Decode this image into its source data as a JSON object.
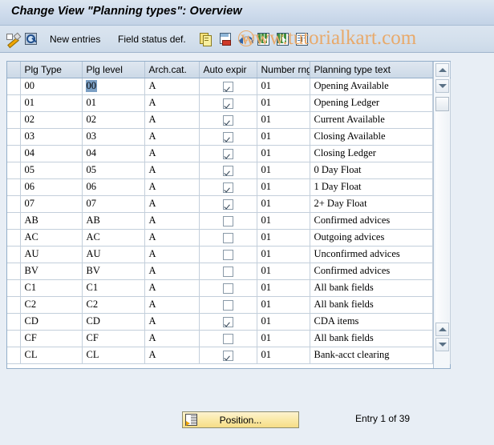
{
  "window": {
    "title": "Change View \"Planning types\": Overview"
  },
  "toolbar": {
    "items": [
      {
        "name": "change-display-icon",
        "label": "",
        "icon": "pencil-icon"
      },
      {
        "name": "display-details-icon",
        "label": "",
        "icon": "magnifier-icon"
      },
      {
        "name": "new-entries-button",
        "label": "New entries",
        "icon": ""
      },
      {
        "name": "field-status-def-button",
        "label": "Field status def.",
        "icon": ""
      },
      {
        "name": "copy-as-icon",
        "label": "",
        "icon": "copy-icon"
      },
      {
        "name": "delete-icon",
        "label": "",
        "icon": "delete-row-icon"
      },
      {
        "name": "undo-icon",
        "label": "",
        "icon": "undo-icon"
      },
      {
        "name": "select-all-icon",
        "label": "",
        "icon": "select-all-icon"
      },
      {
        "name": "deselect-all-icon",
        "label": "",
        "icon": "deselect-all-icon"
      },
      {
        "name": "select-block-icon",
        "label": "",
        "icon": "select-block-icon"
      }
    ]
  },
  "watermark": {
    "text": "www.tutorialkart.com",
    "mark": "c",
    "color": "#e8a96a"
  },
  "table": {
    "config_icon": "table-settings-icon",
    "columns": [
      {
        "key": "plg_type",
        "label": "Plg Type",
        "width": 77,
        "type": "key"
      },
      {
        "key": "plg_level",
        "label": "Plg level",
        "width": 78,
        "type": "text"
      },
      {
        "key": "arch_cat",
        "label": "Arch.cat.",
        "width": 68,
        "type": "text"
      },
      {
        "key": "auto_expir",
        "label": "Auto expir",
        "width": 72,
        "type": "check"
      },
      {
        "key": "number_rng",
        "label": "Number rng",
        "width": 66,
        "type": "text"
      },
      {
        "key": "type_text",
        "label": "Planning type text",
        "width": 138,
        "type": "longtext"
      }
    ],
    "selected_cell": {
      "row": 0,
      "column": "plg_level"
    },
    "rows": [
      {
        "plg_type": "00",
        "plg_level": "00",
        "arch_cat": "A",
        "auto_expir": true,
        "number_rng": "01",
        "type_text": "Opening Available"
      },
      {
        "plg_type": "01",
        "plg_level": "01",
        "arch_cat": "A",
        "auto_expir": true,
        "number_rng": "01",
        "type_text": "Opening Ledger"
      },
      {
        "plg_type": "02",
        "plg_level": "02",
        "arch_cat": "A",
        "auto_expir": true,
        "number_rng": "01",
        "type_text": "Current Available"
      },
      {
        "plg_type": "03",
        "plg_level": "03",
        "arch_cat": "A",
        "auto_expir": true,
        "number_rng": "01",
        "type_text": "Closing Available"
      },
      {
        "plg_type": "04",
        "plg_level": "04",
        "arch_cat": "A",
        "auto_expir": true,
        "number_rng": "01",
        "type_text": "Closing Ledger"
      },
      {
        "plg_type": "05",
        "plg_level": "05",
        "arch_cat": "A",
        "auto_expir": true,
        "number_rng": "01",
        "type_text": "0 Day Float"
      },
      {
        "plg_type": "06",
        "plg_level": "06",
        "arch_cat": "A",
        "auto_expir": true,
        "number_rng": "01",
        "type_text": "1 Day Float"
      },
      {
        "plg_type": "07",
        "plg_level": "07",
        "arch_cat": "A",
        "auto_expir": true,
        "number_rng": "01",
        "type_text": "2+ Day Float"
      },
      {
        "plg_type": "AB",
        "plg_level": "AB",
        "arch_cat": "A",
        "auto_expir": false,
        "number_rng": "01",
        "type_text": "Confirmed advices"
      },
      {
        "plg_type": "AC",
        "plg_level": "AC",
        "arch_cat": "A",
        "auto_expir": false,
        "number_rng": "01",
        "type_text": "Outgoing advices"
      },
      {
        "plg_type": "AU",
        "plg_level": "AU",
        "arch_cat": "A",
        "auto_expir": false,
        "number_rng": "01",
        "type_text": "Unconfirmed advices"
      },
      {
        "plg_type": "BV",
        "plg_level": "BV",
        "arch_cat": "A",
        "auto_expir": false,
        "number_rng": "01",
        "type_text": "Confirmed advices"
      },
      {
        "plg_type": "C1",
        "plg_level": "C1",
        "arch_cat": "A",
        "auto_expir": false,
        "number_rng": "01",
        "type_text": "All bank fields"
      },
      {
        "plg_type": "C2",
        "plg_level": "C2",
        "arch_cat": "A",
        "auto_expir": false,
        "number_rng": "01",
        "type_text": "All bank fields"
      },
      {
        "plg_type": "CD",
        "plg_level": "CD",
        "arch_cat": "A",
        "auto_expir": true,
        "number_rng": "01",
        "type_text": "CDA items"
      },
      {
        "plg_type": "CF",
        "plg_level": "CF",
        "arch_cat": "A",
        "auto_expir": false,
        "number_rng": "01",
        "type_text": "All bank fields"
      },
      {
        "plg_type": "CL",
        "plg_level": "CL",
        "arch_cat": "A",
        "auto_expir": true,
        "number_rng": "01",
        "type_text": "Bank-acct clearing"
      }
    ]
  },
  "scrollbar": {
    "up_icon": "scroll-up-icon",
    "down_icon": "scroll-down-icon",
    "thumb": "scroll-thumb"
  },
  "footer": {
    "position_button": {
      "label": "Position...",
      "icon": "position-icon"
    },
    "entry_status": "Entry 1 of 39"
  }
}
